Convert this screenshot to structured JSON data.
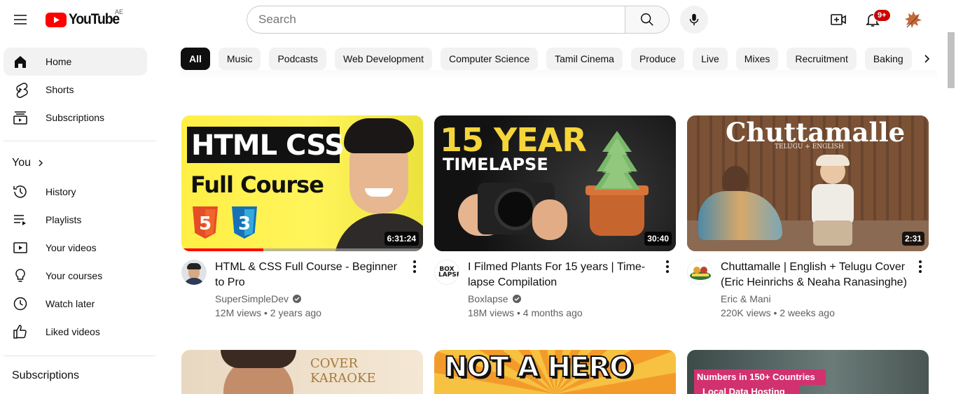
{
  "header": {
    "logo_text": "YouTube",
    "country_code": "AE",
    "search_placeholder": "Search",
    "notification_count": "9+"
  },
  "sidebar": {
    "main": [
      {
        "label": "Home",
        "icon": "home-icon",
        "active": true
      },
      {
        "label": "Shorts",
        "icon": "shorts-icon"
      },
      {
        "label": "Subscriptions",
        "icon": "subscriptions-icon"
      }
    ],
    "you_heading": "You",
    "you": [
      {
        "label": "History",
        "icon": "history-icon"
      },
      {
        "label": "Playlists",
        "icon": "playlists-icon"
      },
      {
        "label": "Your videos",
        "icon": "your-videos-icon"
      },
      {
        "label": "Your courses",
        "icon": "courses-icon"
      },
      {
        "label": "Watch later",
        "icon": "watch-later-icon"
      },
      {
        "label": "Liked videos",
        "icon": "liked-icon"
      }
    ],
    "subscriptions_heading": "Subscriptions"
  },
  "chips": [
    "All",
    "Music",
    "Podcasts",
    "Web Development",
    "Computer Science",
    "Tamil Cinema",
    "Produce",
    "Live",
    "Mixes",
    "Recruitment",
    "Baking"
  ],
  "videos": [
    {
      "title": "HTML & CSS Full Course - Beginner to Pro",
      "channel": "SuperSimpleDev",
      "verified": true,
      "stats": "12M views • 2 years ago",
      "duration": "6:31:24",
      "watched_fraction": 0.34,
      "thumb_text": [
        "HTML CSS",
        "Full Course"
      ]
    },
    {
      "title": "I Filmed Plants For 15 years | Time-lapse Compilation",
      "channel": "Boxlapse",
      "verified": true,
      "stats": "18M views • 4 months ago",
      "duration": "30:40",
      "thumb_text": [
        "15 YEAR",
        "TIMELAPSE"
      ],
      "avatar_text": "BOX LAPSE"
    },
    {
      "title": "Chuttamalle | English + Telugu Cover (Eric Heinrichs & Neaha Ranasinghe)",
      "channel": "Eric & Mani",
      "verified": false,
      "stats": "220K views • 2 weeks ago",
      "duration": "2:31",
      "thumb_text": [
        "Chuttamalle",
        "TELUGU + ENGLISH"
      ]
    }
  ],
  "next_row": [
    {
      "thumb_text": "COVER KARAOKE"
    },
    {
      "thumb_text": "NOT A HERO"
    },
    {
      "thumb_text": [
        "Numbers in 150+ Countries",
        "Local Data Hosting"
      ]
    }
  ],
  "colors": {
    "brand_red": "#ff0000",
    "chip_bg": "#f2f2f2",
    "chip_selected_bg": "#0f0f0f",
    "secondary_text": "#606060"
  }
}
